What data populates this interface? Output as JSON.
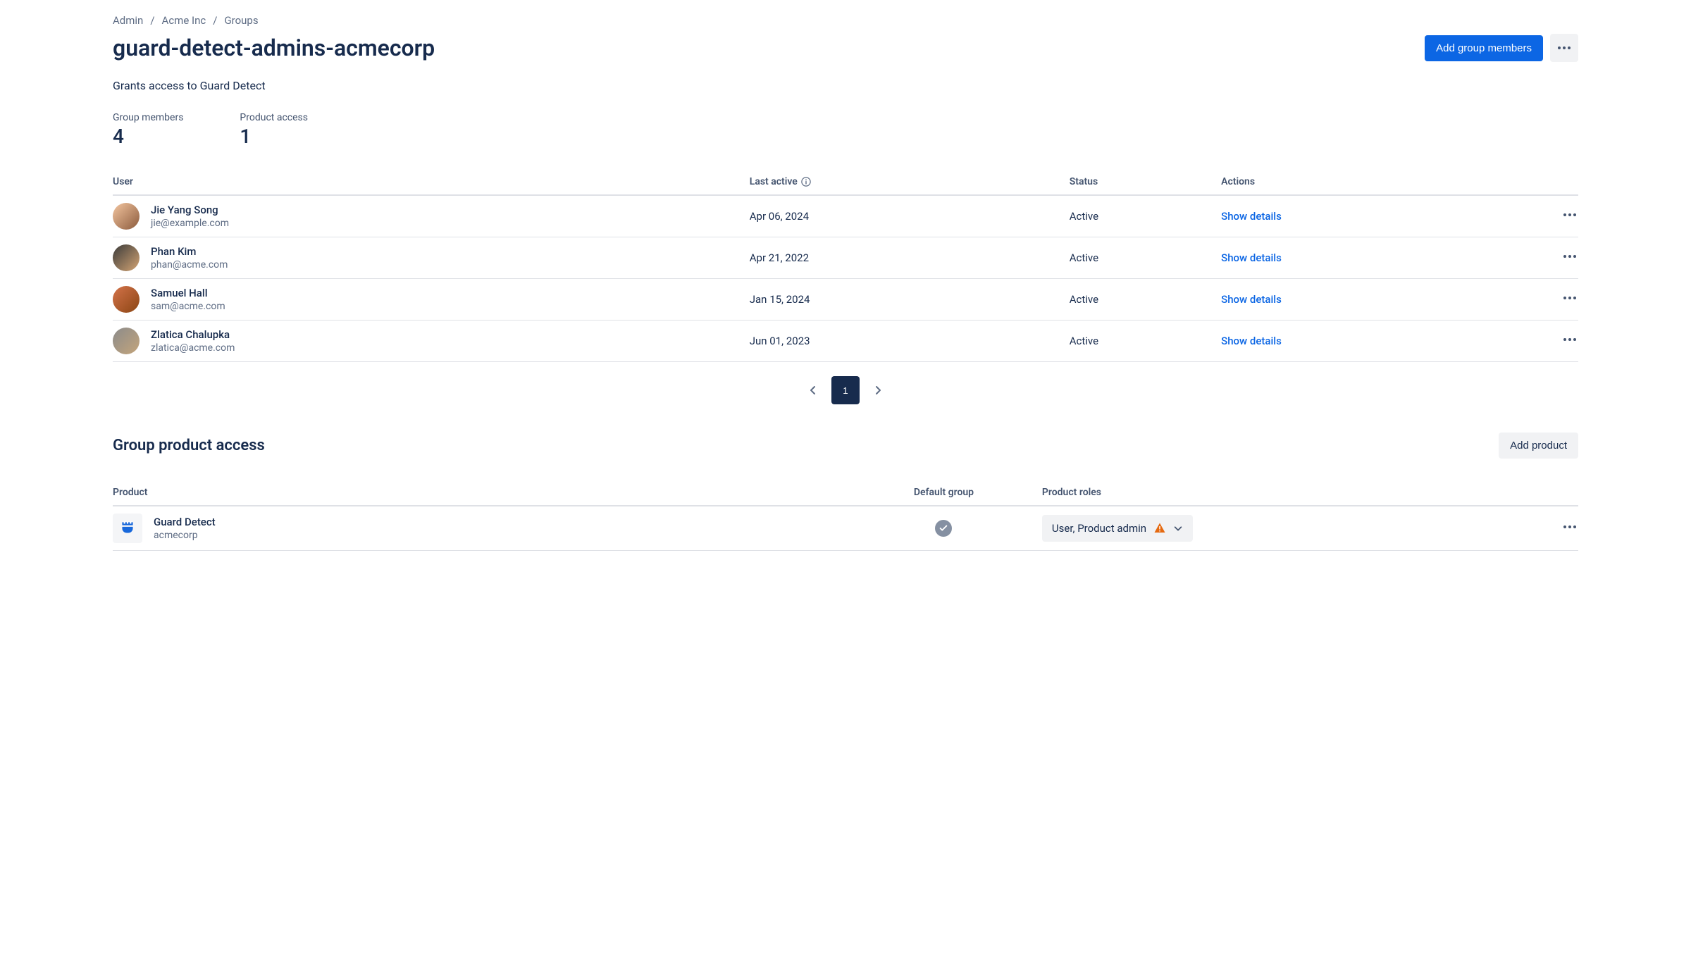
{
  "breadcrumb": {
    "admin": "Admin",
    "org": "Acme Inc",
    "groups": "Groups"
  },
  "header": {
    "title": "guard-detect-admins-acmecorp",
    "add_members_label": "Add group members"
  },
  "description": "Grants access to Guard Detect",
  "stats": {
    "members_label": "Group members",
    "members_value": "4",
    "access_label": "Product access",
    "access_value": "1"
  },
  "table": {
    "headers": {
      "user": "User",
      "last_active": "Last active",
      "status": "Status",
      "actions": "Actions"
    },
    "rows": [
      {
        "name": "Jie Yang Song",
        "email": "jie@example.com",
        "last_active": "Apr 06, 2024",
        "status": "Active",
        "action": "Show details"
      },
      {
        "name": "Phan Kim",
        "email": "phan@acme.com",
        "last_active": "Apr 21, 2022",
        "status": "Active",
        "action": "Show details"
      },
      {
        "name": "Samuel Hall",
        "email": "sam@acme.com",
        "last_active": "Jan 15, 2024",
        "status": "Active",
        "action": "Show details"
      },
      {
        "name": "Zlatica Chalupka",
        "email": "zlatica@acme.com",
        "last_active": "Jun 01, 2023",
        "status": "Active",
        "action": "Show details"
      }
    ]
  },
  "pagination": {
    "current": "1"
  },
  "product_access": {
    "title": "Group product access",
    "add_label": "Add product",
    "headers": {
      "product": "Product",
      "default_group": "Default group",
      "roles": "Product roles"
    },
    "row": {
      "name": "Guard Detect",
      "site": "acmecorp",
      "roles": "User, Product admin"
    }
  }
}
